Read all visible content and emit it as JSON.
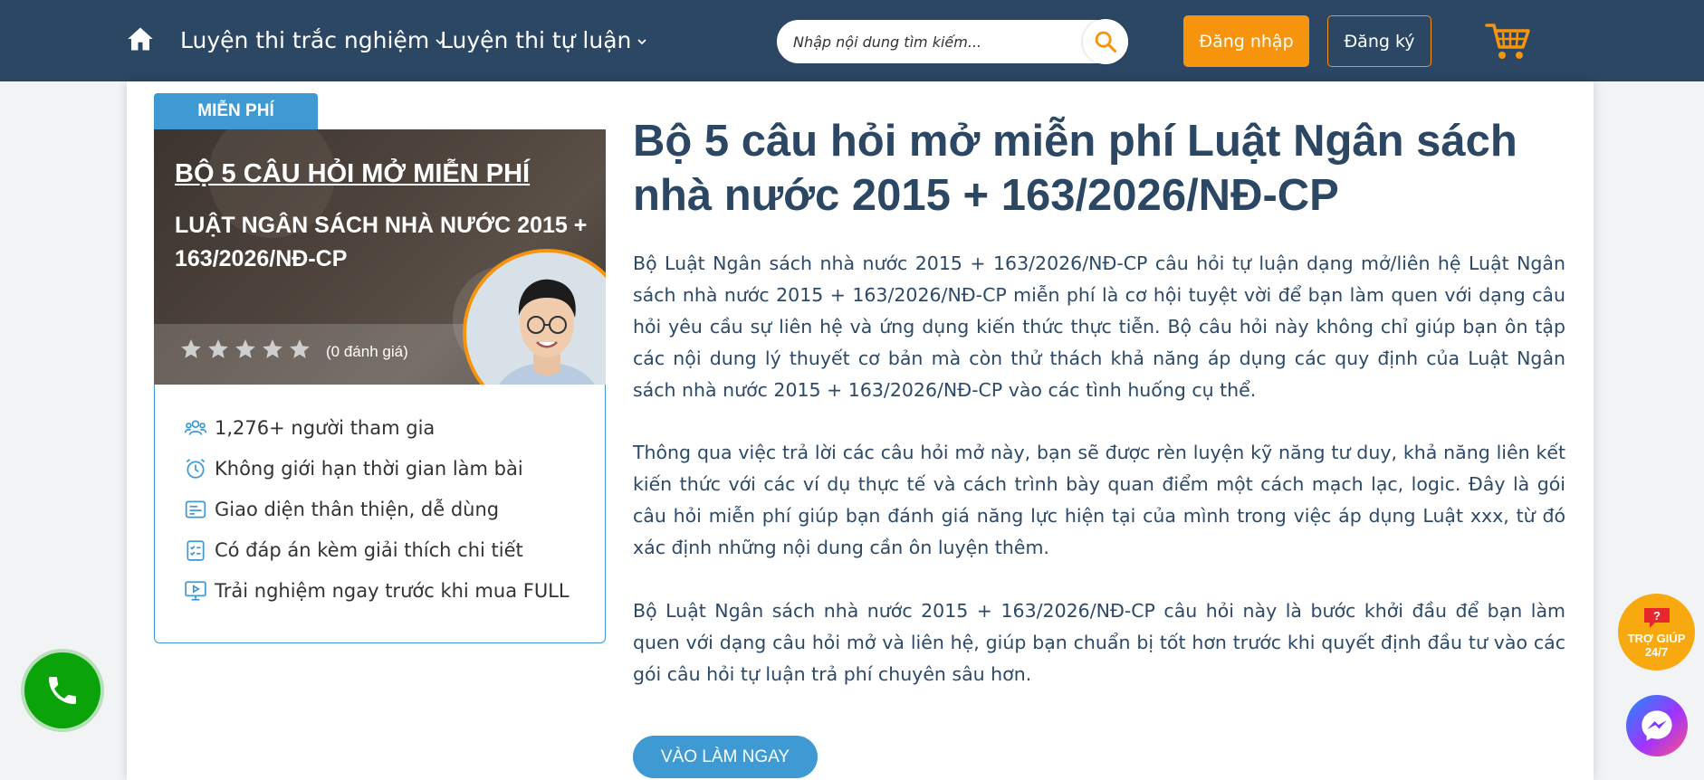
{
  "header": {
    "nav": [
      {
        "label": "Luyện thi trắc nghiệm"
      },
      {
        "label": "Luyện thi tự luận"
      }
    ],
    "search": {
      "placeholder": "Nhập nội dung tìm kiếm..."
    },
    "login_label": "Đăng nhập",
    "register_label": "Đăng ký"
  },
  "product": {
    "ribbon": "MIỄN PHÍ",
    "banner_title": "BỘ 5 CÂU HỎI MỞ MIỄN PHÍ",
    "banner_subtitle": "LUẬT NGÂN SÁCH NHÀ NƯỚC 2015 + 163/2026/NĐ-CP",
    "rating": 0,
    "rating_max": 5,
    "rating_count": "(0 đánh giá)",
    "features": [
      {
        "icon": "users-icon",
        "text": "1,276+ người tham gia"
      },
      {
        "icon": "alarm-clock-icon",
        "text": "Không giới hạn thời gian làm bài"
      },
      {
        "icon": "interface-icon",
        "text": "Giao diện thân thiện, dễ dùng"
      },
      {
        "icon": "checklist-icon",
        "text": "Có đáp án kèm giải thích chi tiết"
      },
      {
        "icon": "monitor-play-icon",
        "text": "Trải nghiệm ngay trước khi mua FULL"
      }
    ]
  },
  "main": {
    "title": "Bộ 5 câu hỏi mở miễn phí Luật Ngân sách nhà nước 2015 + 163/2026/NĐ-CP",
    "paragraphs": [
      "Bộ Luật Ngân sách nhà nước 2015 + 163/2026/NĐ-CP câu hỏi tự luận dạng mở/liên hệ Luật Ngân sách nhà nước 2015 + 163/2026/NĐ-CP miễn phí là cơ hội tuyệt vời để bạn làm quen với dạng câu hỏi yêu cầu sự liên hệ và ứng dụng kiến thức thực tiễn. Bộ câu hỏi này không chỉ giúp bạn ôn tập các nội dung lý thuyết cơ bản mà còn thử thách khả năng áp dụng các quy định của Luật Ngân sách nhà nước 2015 + 163/2026/NĐ-CP vào các tình huống cụ thể.",
      "Thông qua việc trả lời các câu hỏi mở này, bạn sẽ được rèn luyện kỹ năng tư duy, khả năng liên kết kiến thức với các ví dụ thực tế và cách trình bày quan điểm một cách mạch lạc, logic. Đây là gói câu hỏi miễn phí giúp bạn đánh giá năng lực hiện tại của mình trong việc áp dụng Luật xxx, từ đó xác định những nội dung cần ôn luyện thêm.",
      "Bộ Luật Ngân sách nhà nước 2015 + 163/2026/NĐ-CP câu hỏi này là bước khởi đầu để bạn làm quen với dạng câu hỏi mở và liên hệ, giúp bạn chuẩn bị tốt hơn trước khi quyết định đầu tư vào các gói câu hỏi tự luận trả phí chuyên sâu hơn."
    ],
    "cta_label": "VÀO LÀM NGAY"
  },
  "floating": {
    "help_label_1": "TRỢ GIÚP",
    "help_label_2": "24/7"
  },
  "colors": {
    "header_bg": "#2b4764",
    "accent_orange": "#f7940d",
    "accent_blue": "#3f9ad3",
    "phone_green": "#0aa30a"
  }
}
